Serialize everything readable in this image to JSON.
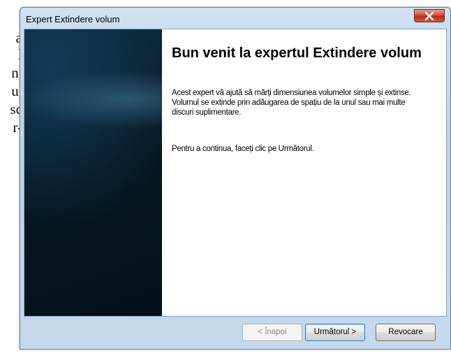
{
  "background_text": [
    "a",
    "l",
    "n.",
    "u,",
    "sc",
    "r-"
  ],
  "window": {
    "title": "Expert Extindere volum",
    "close_label": "x"
  },
  "wizard": {
    "heading": "Bun venit la expertul Extindere volum",
    "description": "Acest expert vă ajută să mărți dimensiunea volumelor simple și extinse. Volumul se extinde prin adăugarea de spațiu de la unul sau mai multe discuri suplimentare.",
    "continue_text": "Pentru a continua, faceți clic pe Următorul."
  },
  "buttons": {
    "back": "< Înapoi",
    "next": "Următorul >",
    "cancel": "Revocare"
  },
  "colors": {
    "close_button": "#c8432e",
    "banner": "#061824",
    "window_frame": "#bcd3ea"
  }
}
